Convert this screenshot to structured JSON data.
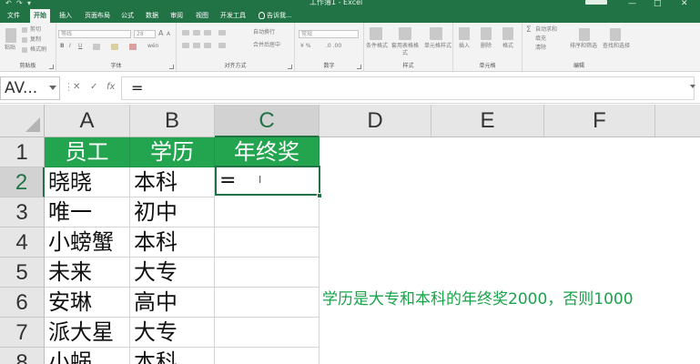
{
  "titlebar": {
    "title": "工作簿1 - Excel",
    "qat": [
      "↶",
      "↷",
      "▾"
    ],
    "window_buttons": [
      "—",
      "□",
      "✕"
    ]
  },
  "tabs": [
    {
      "label": "文件"
    },
    {
      "label": "开始"
    },
    {
      "label": "插入"
    },
    {
      "label": "页面布局"
    },
    {
      "label": "公式"
    },
    {
      "label": "数据"
    },
    {
      "label": "审阅"
    },
    {
      "label": "视图"
    },
    {
      "label": "开发工具"
    },
    {
      "label": "告诉我..."
    }
  ],
  "ribbon": {
    "clipboard": {
      "paste": "粘贴",
      "cut": "剪切",
      "copy": "复制",
      "format_painter": "格式刷",
      "label": "剪贴板"
    },
    "font": {
      "font_name": "等线",
      "font_size": "28",
      "bold": "B",
      "italic": "I",
      "underline": "U",
      "wen": "wén",
      "label": "字体"
    },
    "alignment": {
      "wrap": "自动换行",
      "merge": "合并后居中",
      "label": "对齐方式"
    },
    "number": {
      "format": "常规",
      "label": "数字"
    },
    "styles": {
      "conditional": "条件格式",
      "table": "套用表格格式",
      "cell_styles": "单元格样式",
      "label": "样式"
    },
    "cells": {
      "insert": "插入",
      "delete": "删除",
      "format": "格式",
      "label": "单元格"
    },
    "editing": {
      "autosum": "自动求和",
      "fill": "填充",
      "clear": "清除",
      "sort_filter": "排序和筛选",
      "find_select": "查找和选择",
      "label": "编辑"
    }
  },
  "formula_bar": {
    "name_box": "AV...",
    "cancel": "✕",
    "enter": "✓",
    "fx": "fx",
    "content": "="
  },
  "columns": [
    "A",
    "B",
    "C",
    "D",
    "E",
    "F"
  ],
  "rows": [
    "1",
    "2",
    "3",
    "4",
    "5",
    "6",
    "7",
    "8"
  ],
  "selected_column": "C",
  "selected_row": "2",
  "table": {
    "header": [
      "员工",
      "学历",
      "年终奖"
    ],
    "rows": [
      [
        "晓晓",
        "本科"
      ],
      [
        "唯一",
        "初中"
      ],
      [
        "小螃蟹",
        "本科"
      ],
      [
        "未来",
        "大专"
      ],
      [
        "安琳",
        "高中"
      ],
      [
        "派大星",
        "大专"
      ],
      [
        "小蜗",
        "本科"
      ]
    ]
  },
  "active_cell": {
    "ref": "C2",
    "value": "="
  },
  "note": "学历是大专和本科的年终奖2000，否则1000",
  "colors": {
    "excel_green": "#217346",
    "header_fill": "#22a54e",
    "note_text": "#1aa34a"
  }
}
